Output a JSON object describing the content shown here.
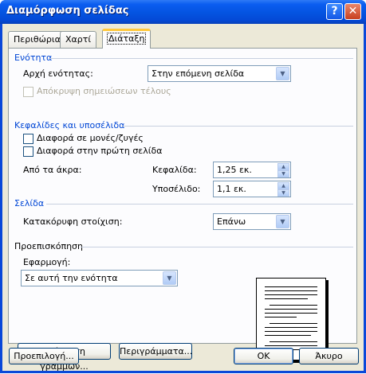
{
  "window": {
    "title": "Διαμόρφωση σελίδας",
    "help_glyph": "?",
    "close_glyph": "✕"
  },
  "tabs": [
    {
      "label": "Περιθώρια",
      "active": false
    },
    {
      "label": "Χαρτί",
      "active": false
    },
    {
      "label": "Διάταξη",
      "active": true
    }
  ],
  "section_start": {
    "title": "Ενότητα",
    "start_label": "Αρχή ενότητας:",
    "start_value": "Στην επόμενη σελίδα",
    "suppress_endnotes_label": "Απόκρυψη σημειώσεων τέλους",
    "suppress_endnotes_checked": false,
    "suppress_endnotes_enabled": false
  },
  "headers_footers": {
    "title": "Κεφαλίδες και υποσέλιδα",
    "odd_even_label": "Διαφορά σε μονές/ζυγές",
    "odd_even_checked": false,
    "first_page_label": "Διαφορά στην πρώτη σελίδα",
    "first_page_checked": false,
    "from_edge_label": "Από τα άκρα:",
    "header_label": "Κεφαλίδα:",
    "header_value": "1,25 εκ.",
    "footer_label": "Υποσέλιδο:",
    "footer_value": "1,1 εκ."
  },
  "page": {
    "title": "Σελίδα",
    "valign_label": "Κατακόρυφη στοίχιση:",
    "valign_value": "Επάνω"
  },
  "preview": {
    "title": "Προεπισκόπηση",
    "apply_label": "Εφαρμογή:",
    "apply_value": "Σε αυτή την ενότητα"
  },
  "buttons": {
    "line_numbers": "Αρίθμηση γραμμών...",
    "borders": "Περιγράμματα...",
    "default": "Προεπιλογή...",
    "ok": "OK",
    "cancel": "Άκυρο"
  },
  "icons": {
    "dropdown_arrow": "▼",
    "spin_up": "▲",
    "spin_down": "▼"
  }
}
